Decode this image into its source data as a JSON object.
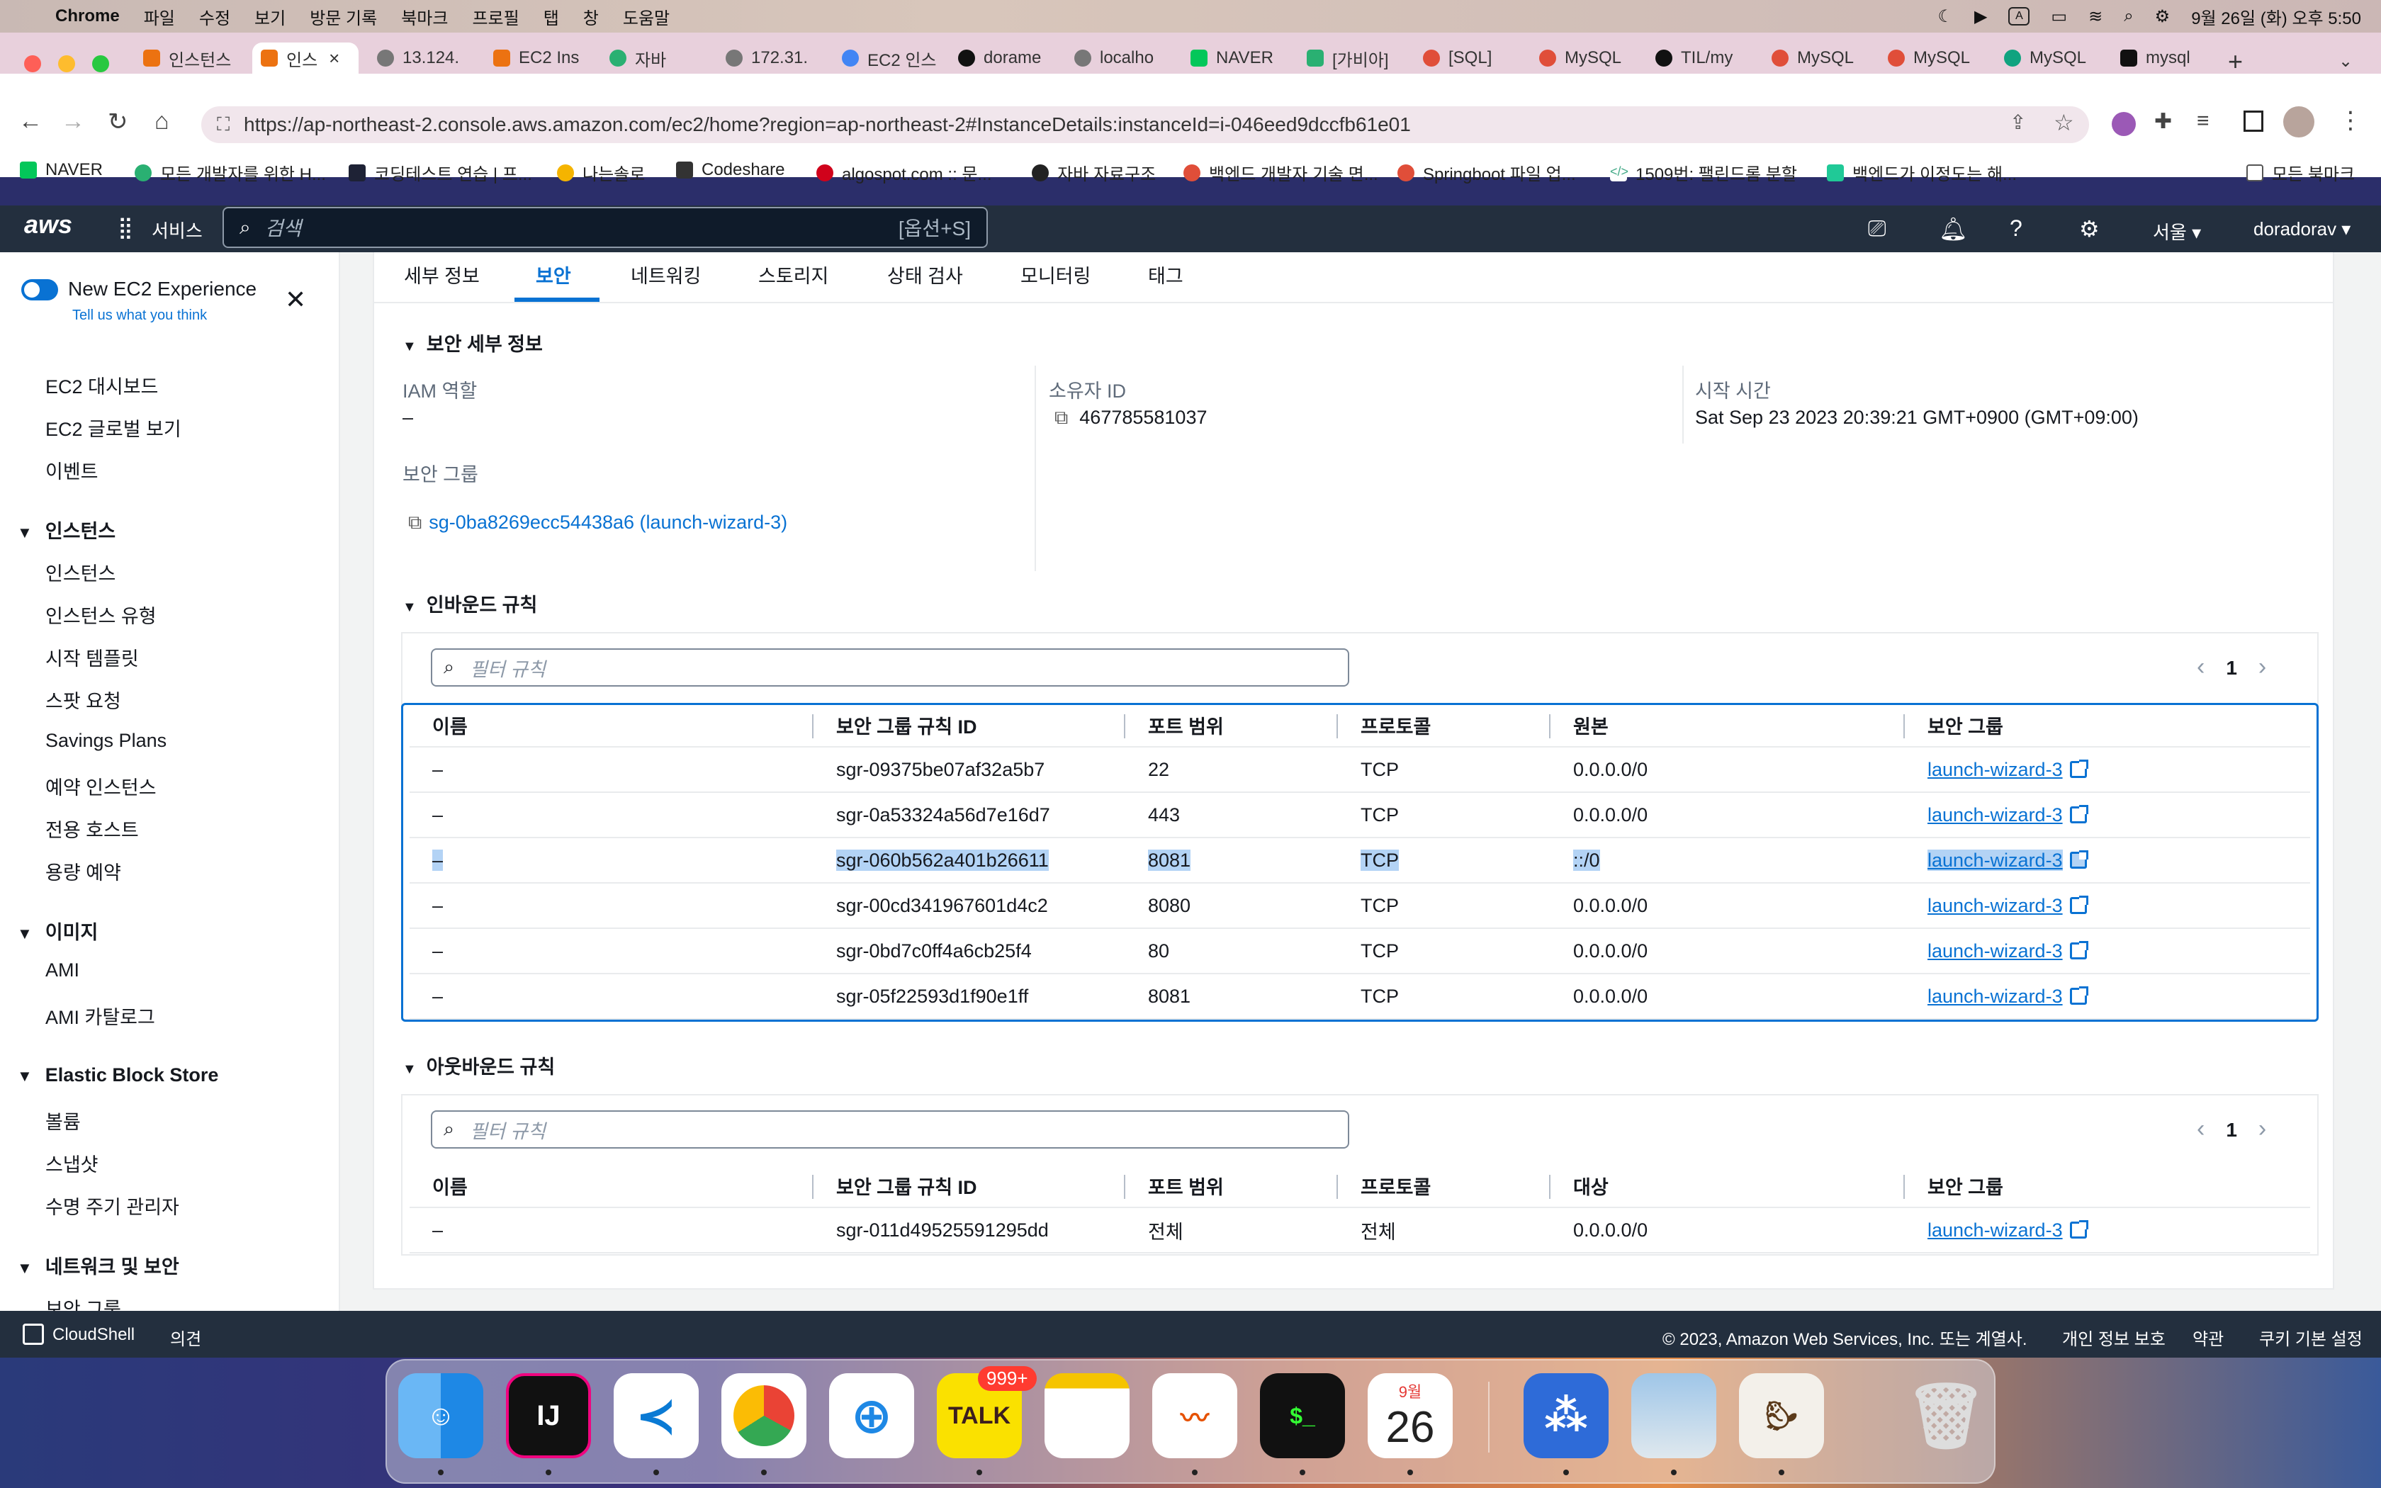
{
  "menubar": {
    "app": "Chrome",
    "items": [
      "파일",
      "수정",
      "보기",
      "방문 기록",
      "북마크",
      "프로필",
      "탭",
      "창",
      "도움말"
    ],
    "datetime": "9월 26일 (화) 오후 5:50"
  },
  "tabs": [
    {
      "label": "인스턴스"
    },
    {
      "label": "인스",
      "active": true
    },
    {
      "label": "13.124."
    },
    {
      "label": "EC2 Ins"
    },
    {
      "label": "자바"
    },
    {
      "label": "172.31."
    },
    {
      "label": "EC2 인스"
    },
    {
      "label": "dorame"
    },
    {
      "label": "localho"
    },
    {
      "label": "NAVER"
    },
    {
      "label": "[가비아]"
    },
    {
      "label": "[SQL]"
    },
    {
      "label": "MySQL"
    },
    {
      "label": "TIL/my"
    },
    {
      "label": "MySQL"
    },
    {
      "label": "MySQL"
    },
    {
      "label": "MySQL"
    },
    {
      "label": "mysql"
    }
  ],
  "address": {
    "url": "https://ap-northeast-2.console.aws.amazon.com/ec2/home?region=ap-northeast-2#InstanceDetails:instanceId=i-046eed9dccfb61e01"
  },
  "bookmarks": [
    "NAVER",
    "모든 개발자를 위한 H...",
    "코딩테스트 연습 | 프...",
    "나는솔로",
    "Codeshare",
    "algospot.com :: 문...",
    "자바 자료구조",
    "백엔드 개발자 기술 면...",
    "Springboot 파일 업...",
    "1509번: 팰린드롬 분할",
    "백엔드가 이정도는 해...",
    "모든 북마크"
  ],
  "aws": {
    "services": "서비스",
    "search_placeholder": "검색",
    "search_shortcut": "[옵션+S]",
    "region": "서울",
    "user": "doradorav"
  },
  "sidebar": {
    "new_exp": "New EC2 Experience",
    "tell_us": "Tell us what you think",
    "top_items": [
      "EC2 대시보드",
      "EC2 글로벌 보기",
      "이벤트"
    ],
    "sections": [
      {
        "title": "인스턴스",
        "items": [
          "인스턴스",
          "인스턴스 유형",
          "시작 템플릿",
          "스팟 요청",
          "Savings Plans",
          "예약 인스턴스",
          "전용 호스트",
          "용량 예약"
        ]
      },
      {
        "title": "이미지",
        "items": [
          "AMI",
          "AMI 카탈로그"
        ]
      },
      {
        "title": "Elastic Block Store",
        "items": [
          "볼륨",
          "스냅샷",
          "수명 주기 관리자"
        ]
      },
      {
        "title": "네트워크 및 보안",
        "items": [
          "보안 그룹"
        ]
      }
    ]
  },
  "content_tabs": [
    "세부 정보",
    "보안",
    "네트워킹",
    "스토리지",
    "상태 검사",
    "모니터링",
    "태그"
  ],
  "security": {
    "heading": "보안 세부 정보",
    "iam_label": "IAM 역할",
    "iam_value": "–",
    "owner_label": "소유자 ID",
    "owner_value": "467785581037",
    "launch_label": "시작 시간",
    "launch_value": "Sat Sep 23 2023 20:39:21 GMT+0900 (GMT+09:00)",
    "sg_label": "보안 그룹",
    "sg_value": "sg-0ba8269ecc54438a6 (launch-wizard-3)"
  },
  "inbound": {
    "heading": "인바운드 규칙",
    "filter_placeholder": "필터 규칙",
    "page": "1",
    "columns": [
      "이름",
      "보안 그룹 규칙 ID",
      "포트 범위",
      "프로토콜",
      "원본",
      "보안 그룹"
    ],
    "rows": [
      [
        "–",
        "sgr-09375be07af32a5b7",
        "22",
        "TCP",
        "0.0.0.0/0",
        "launch-wizard-3"
      ],
      [
        "–",
        "sgr-0a53324a56d7e16d7",
        "443",
        "TCP",
        "0.0.0.0/0",
        "launch-wizard-3"
      ],
      [
        "–",
        "sgr-060b562a401b26611",
        "8081",
        "TCP",
        "::/0",
        "launch-wizard-3"
      ],
      [
        "–",
        "sgr-00cd341967601d4c2",
        "8080",
        "TCP",
        "0.0.0.0/0",
        "launch-wizard-3"
      ],
      [
        "–",
        "sgr-0bd7c0ff4a6cb25f4",
        "80",
        "TCP",
        "0.0.0.0/0",
        "launch-wizard-3"
      ],
      [
        "–",
        "sgr-05f22593d1f90e1ff",
        "8081",
        "TCP",
        "0.0.0.0/0",
        "launch-wizard-3"
      ]
    ],
    "selected_row": 2
  },
  "outbound": {
    "heading": "아웃바운드 규칙",
    "filter_placeholder": "필터 규칙",
    "page": "1",
    "columns": [
      "이름",
      "보안 그룹 규칙 ID",
      "포트 범위",
      "프로토콜",
      "대상",
      "보안 그룹"
    ],
    "rows": [
      [
        "–",
        "sgr-011d49525591295dd",
        "전체",
        "전체",
        "0.0.0.0/0",
        "launch-wizard-3"
      ]
    ]
  },
  "footer": {
    "cloudshell": "CloudShell",
    "feedback": "의견",
    "copyright": "© 2023, Amazon Web Services, Inc. 또는 계열사.",
    "privacy": "개인 정보 보호",
    "terms": "약관",
    "cookies": "쿠키 기본 설정"
  },
  "dock": {
    "talk_badge": "999+",
    "calendar_month": "9월",
    "calendar_day": "26",
    "talk_label": "TALK",
    "ij_label": "IJ"
  },
  "colors": {
    "accent": "#0972d3",
    "aws_header": "#232f3e",
    "selection": "#b3d3f5"
  }
}
